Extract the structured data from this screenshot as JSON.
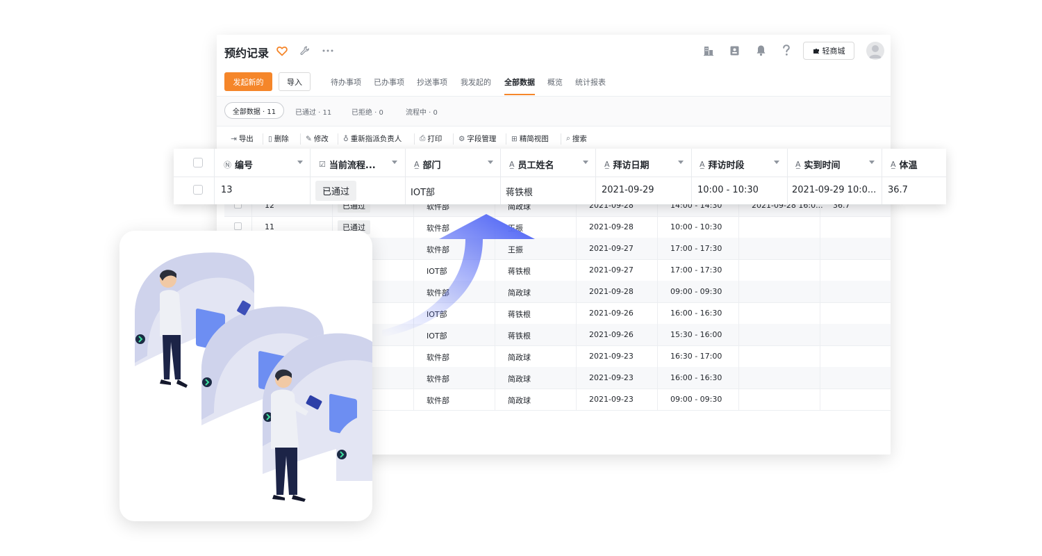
{
  "window": {
    "title": "预约记录",
    "mall_button": "轻商城"
  },
  "tabs": {
    "new_button": "发起新的",
    "import_button": "导入",
    "items": [
      "待办事项",
      "已办事项",
      "抄送事项",
      "我发起的",
      "全部数据",
      "概览",
      "统计报表"
    ],
    "active": "全部数据"
  },
  "filters": {
    "all": "全部数据 · 11",
    "items": [
      "已通过 · 11",
      "已拒绝 · 0",
      "流程中 · 0"
    ]
  },
  "toolbar": {
    "items": [
      "导出",
      "删除",
      "修改",
      "重新指派负责人",
      "打印",
      "字段管理",
      "精简视图",
      "搜索"
    ]
  },
  "panel": {
    "headers": [
      "编号",
      "当前流程...",
      "部门",
      "员工姓名",
      "拜访日期",
      "拜访时段",
      "实到时间",
      "体温"
    ],
    "row": {
      "id": "13",
      "status": "已通过",
      "dept": "IOT部",
      "name": "蒋铁根",
      "date": "2021-09-29",
      "slot": "10:00 - 10:30",
      "arrival": "2021-09-29 10:0...",
      "temp": "36.7"
    }
  },
  "grid": {
    "rows": [
      {
        "id": "12",
        "status": "已通过",
        "dept": "软件部",
        "name": "简政球",
        "date": "2021-09-28",
        "slot": "14:00 - 14:30",
        "arrival": "2021-09-28 16:0...",
        "temp": "36.7"
      },
      {
        "id": "11",
        "status": "已通过",
        "dept": "软件部",
        "name": "王振",
        "date": "2021-09-28",
        "slot": "10:00 - 10:30",
        "arrival": "",
        "temp": ""
      },
      {
        "id": "",
        "status": "",
        "dept": "软件部",
        "name": "王振",
        "date": "2021-09-27",
        "slot": "17:00 - 17:30",
        "arrival": "",
        "temp": ""
      },
      {
        "id": "",
        "status": "",
        "dept": "IOT部",
        "name": "蒋铁根",
        "date": "2021-09-27",
        "slot": "17:00 - 17:30",
        "arrival": "",
        "temp": ""
      },
      {
        "id": "",
        "status": "",
        "dept": "软件部",
        "name": "简政球",
        "date": "2021-09-28",
        "slot": "09:00 - 09:30",
        "arrival": "",
        "temp": ""
      },
      {
        "id": "",
        "status": "",
        "dept": "IOT部",
        "name": "蒋铁根",
        "date": "2021-09-26",
        "slot": "16:00 - 16:30",
        "arrival": "",
        "temp": ""
      },
      {
        "id": "",
        "status": "",
        "dept": "IOT部",
        "name": "蒋铁根",
        "date": "2021-09-26",
        "slot": "15:30 - 16:00",
        "arrival": "",
        "temp": ""
      },
      {
        "id": "",
        "status": "",
        "dept": "软件部",
        "name": "简政球",
        "date": "2021-09-23",
        "slot": "16:30 - 17:00",
        "arrival": "",
        "temp": ""
      },
      {
        "id": "",
        "status": "",
        "dept": "软件部",
        "name": "简政球",
        "date": "2021-09-23",
        "slot": "16:00 - 16:30",
        "arrival": "",
        "temp": ""
      },
      {
        "id": "",
        "status": "",
        "dept": "软件部",
        "name": "简政球",
        "date": "2021-09-23",
        "slot": "09:00 - 09:30",
        "arrival": "",
        "temp": ""
      }
    ]
  },
  "icons": {
    "favorite": "heart-icon",
    "settings": "wrench-icon",
    "more": "ellipsis-icon",
    "org": "building-icon",
    "contacts": "contacts-icon",
    "notify": "bell-icon",
    "help": "question-icon",
    "user": "avatar-icon"
  },
  "colors": {
    "accent": "#f5862a",
    "arrow": "#5b6ff5",
    "gate": "#dcdef0",
    "screen": "#6d8ef2"
  }
}
